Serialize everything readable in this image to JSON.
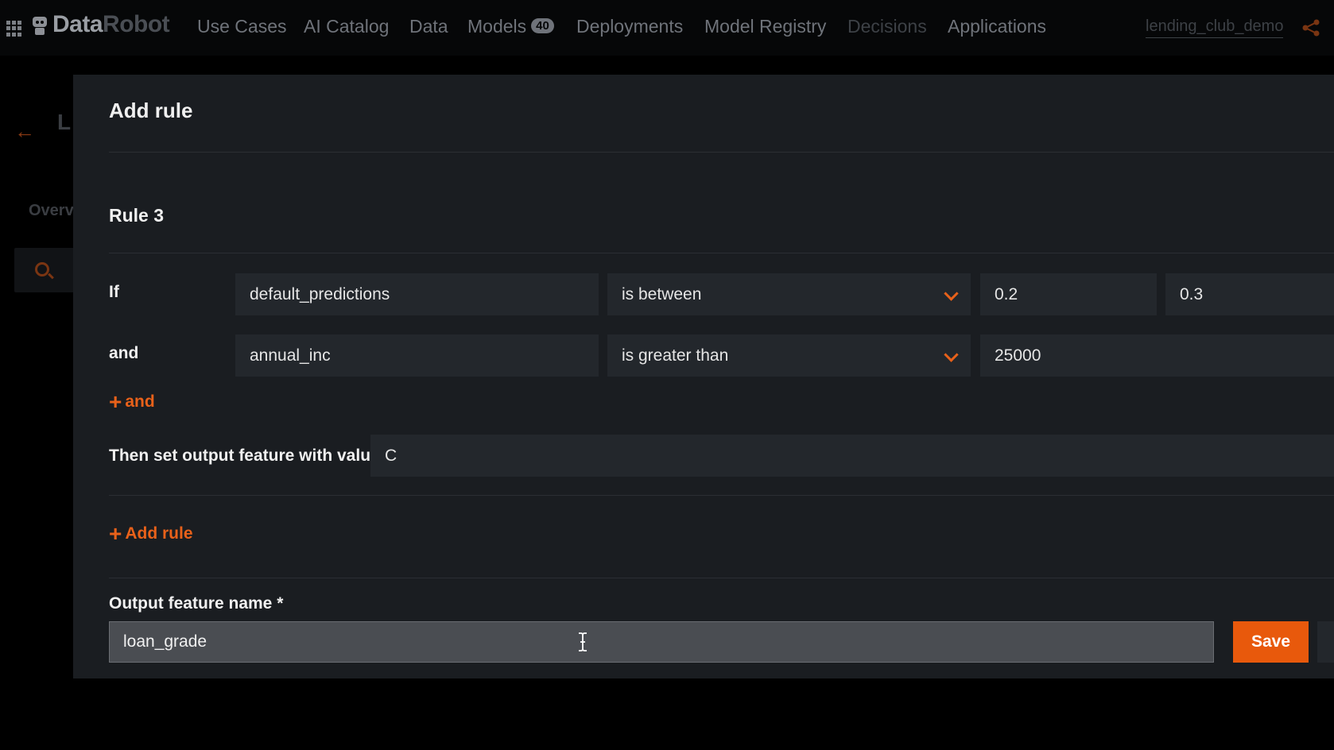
{
  "nav": {
    "brand_part1": "Data",
    "brand_part2": "Robot",
    "items": [
      {
        "label": "Use Cases"
      },
      {
        "label": "AI Catalog"
      },
      {
        "label": "Data"
      },
      {
        "label": "Models",
        "badge": "40"
      },
      {
        "label": "Deployments"
      },
      {
        "label": "Model Registry"
      },
      {
        "label": "Decisions"
      },
      {
        "label": "Applications"
      }
    ],
    "project": "lending_club_demo",
    "icons": [
      "apps-grid-icon",
      "robot-logo-icon",
      "share-icon"
    ]
  },
  "background": {
    "title_fragment": "L",
    "tab_fragment": "Overv"
  },
  "modal": {
    "title": "Add rule",
    "rule_title": "Rule 3",
    "conditions": [
      {
        "label": "If",
        "feature": "default_predictions",
        "operator": "is between",
        "value1": "0.2",
        "value2": "0.3"
      },
      {
        "label": "and",
        "feature": "annual_inc",
        "operator": "is greater than",
        "value1": "25000"
      }
    ],
    "add_condition_label": "and",
    "then_label": "Then set output feature with value",
    "then_value": "C",
    "add_rule_label": "Add rule",
    "output_label": "Output feature name *",
    "output_value": "loan_grade",
    "save_label": "Save"
  },
  "colors": {
    "accent": "#e8611a",
    "save_button": "#e8590c",
    "modal_bg": "#1a1d21",
    "field_bg": "#23272c"
  }
}
